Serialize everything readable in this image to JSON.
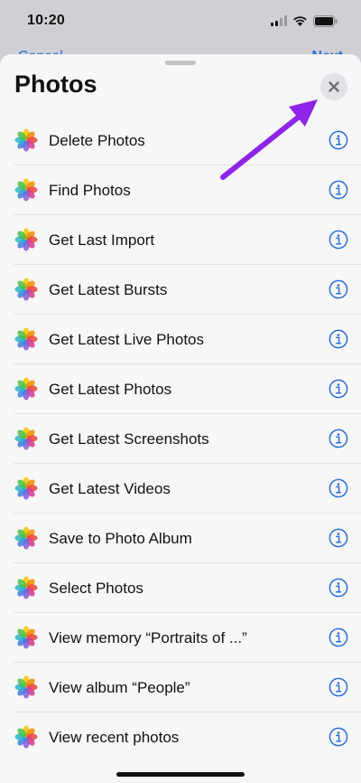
{
  "status_bar": {
    "time": "10:20"
  },
  "behind_nav": {
    "left_label": "Cancel",
    "right_label": "Next"
  },
  "sheet": {
    "title": "Photos"
  },
  "actions": [
    {
      "label": "Delete Photos"
    },
    {
      "label": "Find Photos"
    },
    {
      "label": "Get Last Import"
    },
    {
      "label": "Get Latest Bursts"
    },
    {
      "label": "Get Latest Live Photos"
    },
    {
      "label": "Get Latest Photos"
    },
    {
      "label": "Get Latest Screenshots"
    },
    {
      "label": "Get Latest Videos"
    },
    {
      "label": "Save to Photo Album"
    },
    {
      "label": "Select Photos"
    },
    {
      "label": "View memory “Portraits of ...”"
    },
    {
      "label": "View album “People”"
    },
    {
      "label": "View recent photos"
    }
  ],
  "colors": {
    "accent": "#2a6fd6",
    "annotation_arrow": "#8e24e8"
  },
  "icons": {
    "action_icon": "photos-app-icon",
    "info": "info-icon",
    "close": "close-icon"
  }
}
